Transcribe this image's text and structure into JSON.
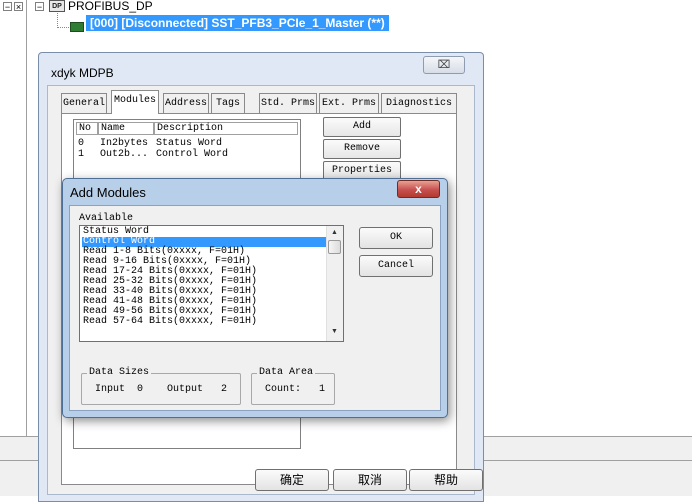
{
  "tree": {
    "toggle_collapse": "−",
    "toggle_close": "×",
    "root_icon_text": "DP",
    "root_label": "PROFIBUS_DP",
    "master_label": "[000] [Disconnected] SST_PFB3_PCIe_1_Master (**)"
  },
  "mdpb_dialog": {
    "title": "xdyk MDPB",
    "close_glyph": "⌧",
    "tabs": [
      "General",
      "Modules",
      "Address",
      "Tags",
      "Std. Prms",
      "Ext. Prms",
      "Diagnostics"
    ],
    "active_tab": "Modules",
    "module_list": {
      "headers": [
        "No",
        "Name",
        "Description"
      ],
      "rows": [
        {
          "no": "0",
          "name": "In2bytes",
          "description": "Status Word"
        },
        {
          "no": "1",
          "name": "Out2b...",
          "description": "Control Word"
        }
      ]
    },
    "buttons": {
      "add": "Add",
      "remove": "Remove",
      "properties": "Properties"
    },
    "footer_buttons": {
      "ok": "确定",
      "cancel": "取消",
      "help": "帮助"
    }
  },
  "add_modules_dialog": {
    "title": "Add Modules",
    "close_glyph": "x",
    "available_label": "Available",
    "available_items": [
      "Status Word",
      "Control Word",
      "Read 1-8 Bits(0xxxx, F=01H)",
      "Read 9-16 Bits(0xxxx, F=01H)",
      "Read 17-24 Bits(0xxxx, F=01H)",
      "Read 25-32 Bits(0xxxx, F=01H)",
      "Read 33-40 Bits(0xxxx, F=01H)",
      "Read 41-48 Bits(0xxxx, F=01H)",
      "Read 49-56 Bits(0xxxx, F=01H)",
      "Read 57-64 Bits(0xxxx, F=01H)"
    ],
    "selected_item": "Control Word",
    "ok_label": "OK",
    "cancel_label": "Cancel",
    "scroll_up_glyph": "▲",
    "scroll_down_glyph": "▼",
    "data_sizes": {
      "title": "Data Sizes",
      "input_label": "Input",
      "input_value": "0",
      "output_label": "Output",
      "output_value": "2"
    },
    "data_area": {
      "title": "Data Area",
      "count_label": "Count:",
      "count_value": "1"
    }
  },
  "colors": {
    "selection": "#3399ff",
    "close_red": "#c75050",
    "dialog_frame": "#b7cfe8"
  }
}
